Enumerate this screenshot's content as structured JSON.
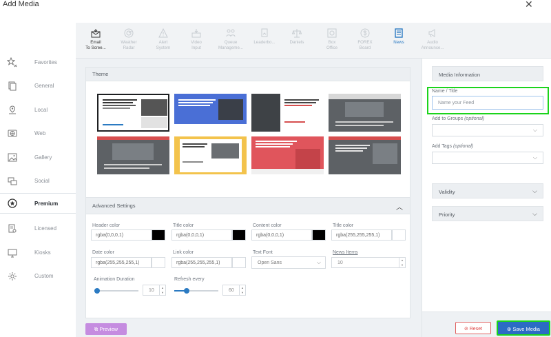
{
  "window": {
    "title": "Add Media",
    "close_glyph": "✕"
  },
  "sidenav": {
    "items": [
      {
        "label": "Favorites",
        "icon": "star-icon"
      },
      {
        "label": "General",
        "icon": "document-icon"
      },
      {
        "label": "Local",
        "icon": "location-icon"
      },
      {
        "label": "Web",
        "icon": "globe-icon"
      },
      {
        "label": "Gallery",
        "icon": "image-icon"
      },
      {
        "label": "Social",
        "icon": "chat-icon"
      },
      {
        "label": "Premium",
        "icon": "premium-icon",
        "active": true
      },
      {
        "label": "Licensed",
        "icon": "license-icon"
      },
      {
        "label": "Kiosks",
        "icon": "monitor-icon"
      },
      {
        "label": "Custom",
        "icon": "gear-icon"
      }
    ]
  },
  "types": [
    {
      "l1": "Email",
      "l2": "To Scree...",
      "icon": "email-icon",
      "state": "sel"
    },
    {
      "l1": "Weather",
      "l2": "Radar",
      "icon": "radar-icon"
    },
    {
      "l1": "Alert",
      "l2": "System",
      "icon": "alert-icon"
    },
    {
      "l1": "Video",
      "l2": "Input",
      "icon": "video-input-icon"
    },
    {
      "l1": "Queue",
      "l2": "Manageme...",
      "icon": "queue-icon"
    },
    {
      "l1": "Leaderbo...",
      "l2": "",
      "icon": "badge-icon"
    },
    {
      "l1": "Daniels",
      "l2": "",
      "icon": "scale-icon"
    },
    {
      "l1": "Box",
      "l2": "Office",
      "icon": "box-office-icon"
    },
    {
      "l1": "FOREX",
      "l2": "Board",
      "icon": "currency-icon"
    },
    {
      "l1": "News",
      "l2": "",
      "icon": "news-icon",
      "state": "cur"
    },
    {
      "l1": "Audio",
      "l2": "Announce...",
      "icon": "megaphone-icon"
    }
  ],
  "theme": {
    "title": "Theme"
  },
  "advanced": {
    "title": "Advanced Settings",
    "header_color": {
      "label": "Header color",
      "value": "rgba(0,0,0,1)",
      "swatch": "#000000"
    },
    "title_color": {
      "label": "Title color",
      "value": "rgba(0,0,0,1)",
      "swatch": "#000000"
    },
    "content_color": {
      "label": "Content color",
      "value": "rgba(0,0,0,1)",
      "swatch": "#000000"
    },
    "title_color2": {
      "label": "Title color",
      "value": "rgba(255,255,255,1)",
      "swatch": "#ffffff"
    },
    "date_color": {
      "label": "Date color",
      "value": "rgba(255,255,255,1)",
      "swatch": "#ffffff"
    },
    "link_color": {
      "label": "Link color",
      "value": "rgba(255,255,255,1)",
      "swatch": "#ffffff"
    },
    "text_font": {
      "label": "Text Font",
      "value": "Open Sans"
    },
    "news_items": {
      "label": "News Items",
      "value": "10"
    },
    "animation_duration": {
      "label": "Animation Duration",
      "value": "10",
      "level": 0
    },
    "refresh_every": {
      "label": "Refresh every",
      "value": "60",
      "level": 0.25
    }
  },
  "buttons": {
    "preview": "Preview",
    "reset": "Reset",
    "save": "Save Media"
  },
  "media_info": {
    "title": "Media Information",
    "name_label": "Name / Title",
    "name_placeholder": "Name your Feed",
    "groups_label": "Add to Groups",
    "groups_hint": "(optional)",
    "tags_label": "Add Tags",
    "tags_hint": "(optional)",
    "validity": "Validity",
    "priority": "Priority"
  },
  "colors": {
    "accent": "#2b7ac2",
    "save": "#2b6cc4",
    "preview": "#c58ce0",
    "highlight": "#1bd41b",
    "reset": "#e06060"
  }
}
